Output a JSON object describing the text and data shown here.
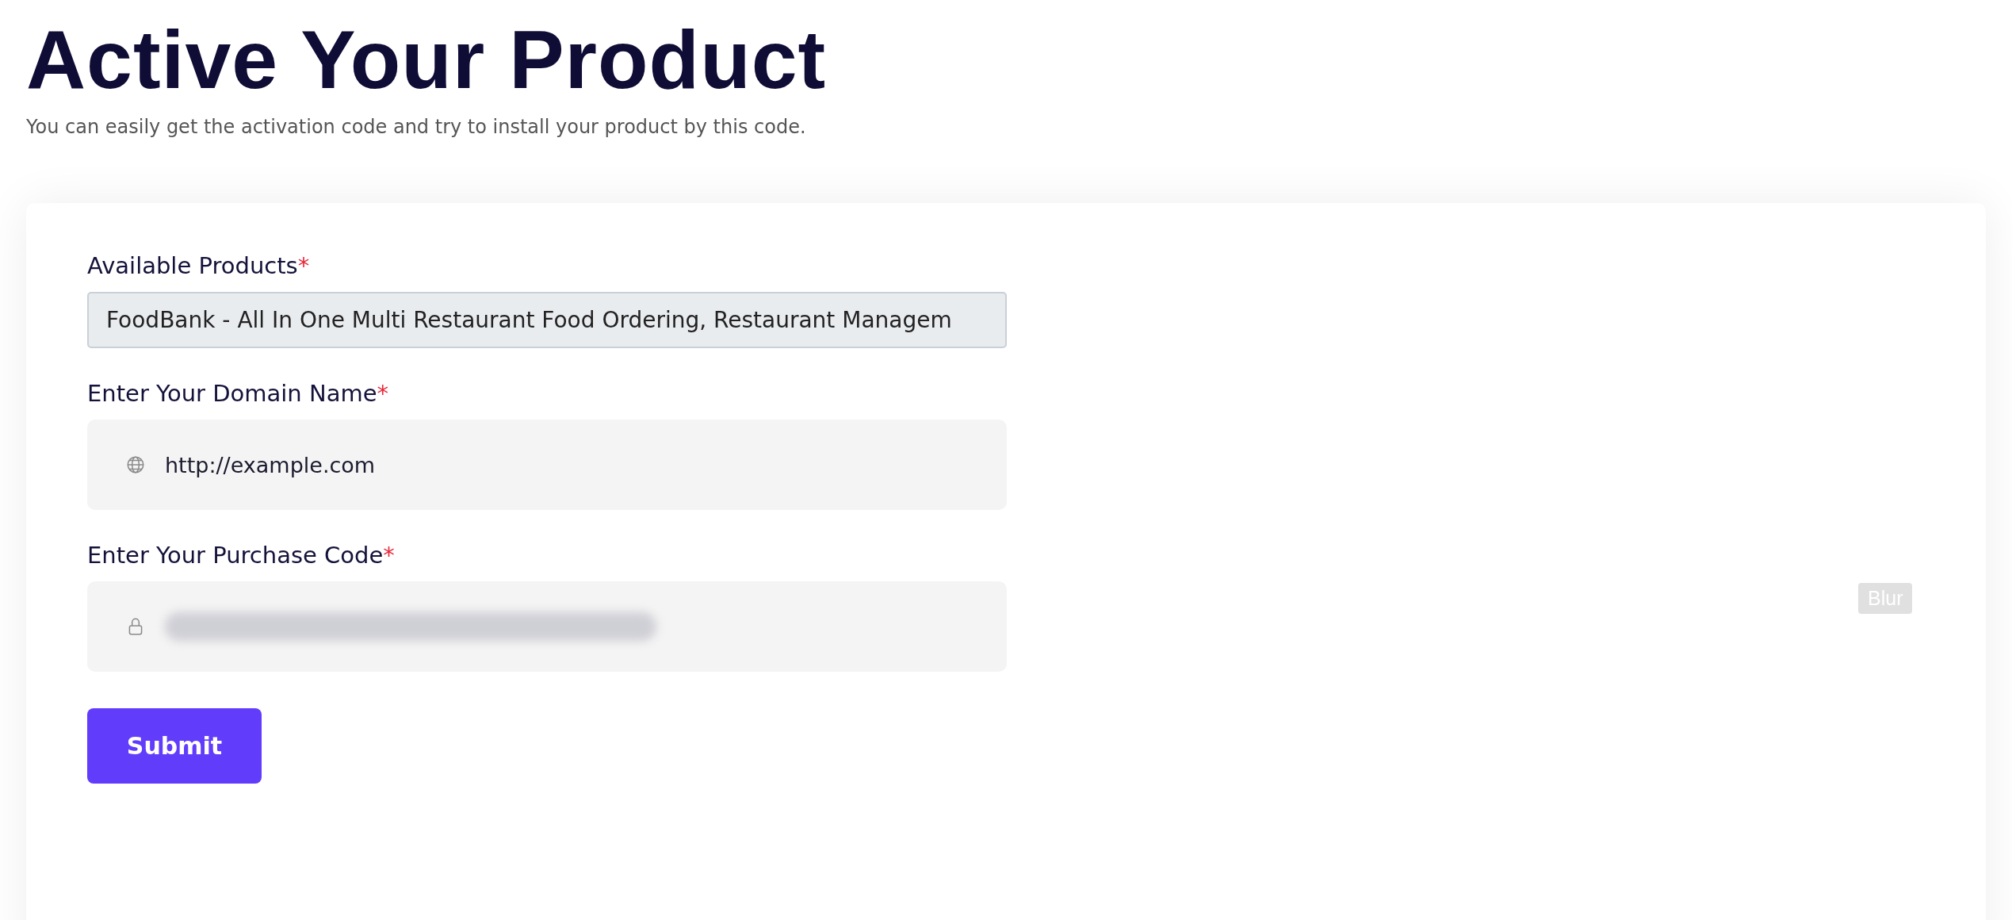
{
  "header": {
    "title": "Active Your Product",
    "subtitle": "You can easily get the activation code and try to install your product by this code."
  },
  "form": {
    "fields": [
      {
        "kind": "select",
        "label": "Available Products",
        "required_mark": "*",
        "value": "FoodBank - All In One Multi Restaurant Food Ordering, Restaurant Managem"
      },
      {
        "kind": "domain",
        "label": "Enter Your Domain Name",
        "required_mark": "*",
        "value": "http://example.com"
      },
      {
        "kind": "code",
        "label": "Enter Your Purchase Code",
        "required_mark": "*",
        "redacted": true
      }
    ],
    "submit": "Submit"
  },
  "badge": "Blur"
}
